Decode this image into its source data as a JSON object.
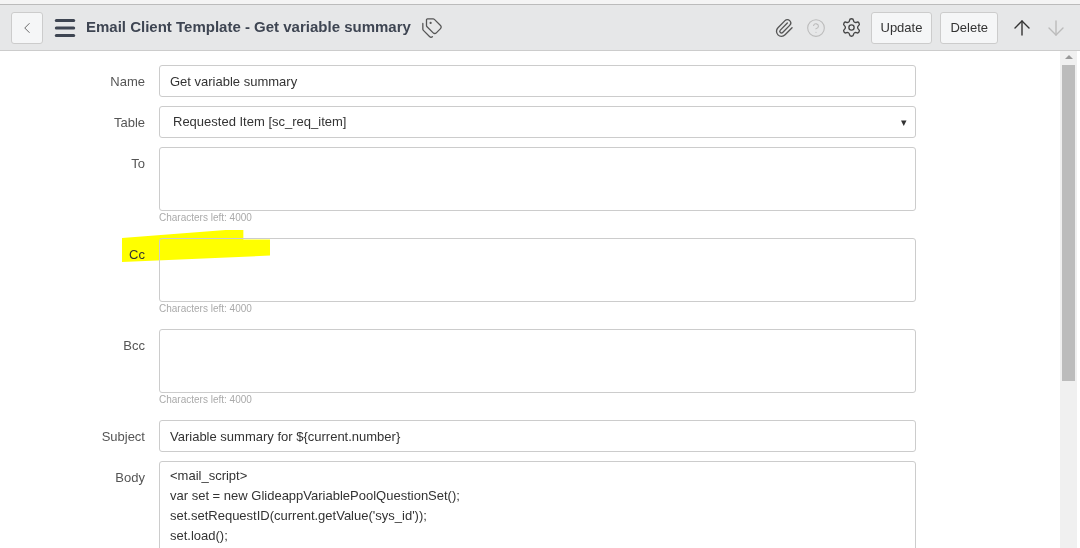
{
  "header": {
    "title": "Email Client Template - Get variable summary",
    "buttons": [
      "Update",
      "Delete"
    ],
    "next_disabled": true
  },
  "fields": [
    {
      "kind": "text",
      "label": "Name",
      "value": "Get variable summary",
      "highlighted": false
    },
    {
      "kind": "select",
      "label": "Table",
      "value": "Requested Item [sc_req_item]",
      "caret": "▾",
      "highlighted": false
    },
    {
      "kind": "area",
      "label": "To",
      "hint": "Characters left: 4000",
      "highlighted": false
    },
    {
      "kind": "area",
      "label": "Cc",
      "hint": "Characters left: 4000",
      "highlighted": true
    },
    {
      "kind": "area",
      "label": "Bcc",
      "hint": "Characters left: 4000",
      "highlighted": false
    },
    {
      "kind": "text",
      "label": "Subject",
      "value": "Variable summary for ${current.number}",
      "highlighted": false
    },
    {
      "kind": "body",
      "label": "Body",
      "lines": [
        "<mail_script>",
        "var set = new GlideappVariablePoolQuestionSet();",
        "set.setRequestID(current.getValue('sys_id'));",
        "set.load();"
      ],
      "highlighted": false
    }
  ]
}
